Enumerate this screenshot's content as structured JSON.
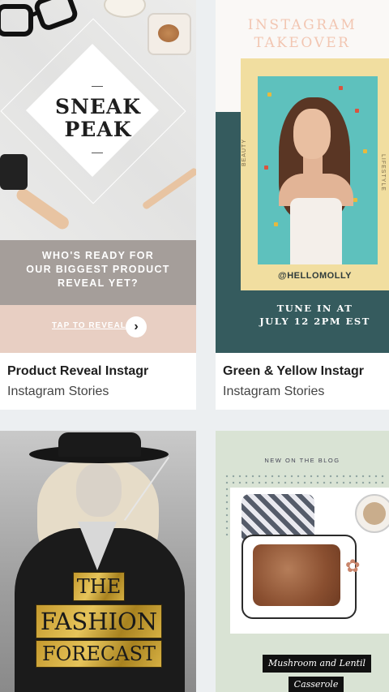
{
  "cards": [
    {
      "title": "Product Reveal Instagr",
      "subtitle": "Instagram Stories",
      "design": {
        "headline_line1": "SNEAK",
        "headline_line2": "PEAK",
        "band_line1": "WHO'S READY FOR",
        "band_line2": "OUR BIGGEST PRODUCT",
        "band_line3": "REVEAL YET?",
        "cta": "TAP TO REVEAL",
        "cta_icon": "chevron-right-icon",
        "colors": {
          "band": "#a59e9a",
          "cta_band": "#e8cfc3"
        }
      }
    },
    {
      "title": "Green & Yellow Instagr",
      "subtitle": "Instagram Stories",
      "design": {
        "heading_line1": "INSTAGRAM",
        "heading_line2": "TAKEOVER",
        "side_left": "BEAUTY",
        "side_right": "LIFESTYLE",
        "handle": "@HELLOMOLLY",
        "tune_line1": "TUNE IN AT",
        "tune_line2": "JULY 12 2PM EST",
        "colors": {
          "teal": "#355b5e",
          "yellow": "#f1dea0",
          "heading": "#f2c6b2"
        }
      }
    },
    {
      "design": {
        "line1": "THE",
        "line2": "FASHION",
        "line3": "FORECAST"
      }
    },
    {
      "design": {
        "label": "NEW ON THE BLOG",
        "tag_line1": "Mushroom and Lentil",
        "tag_line2": "Casserole"
      }
    }
  ]
}
